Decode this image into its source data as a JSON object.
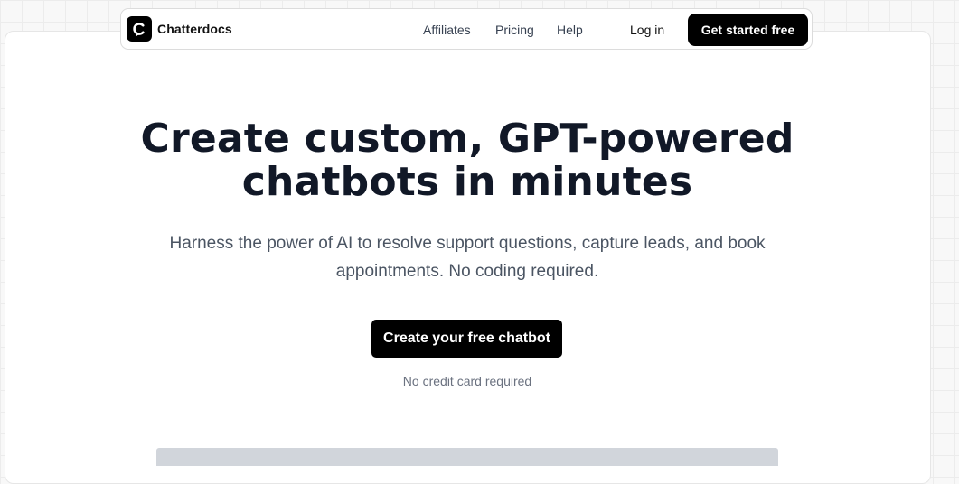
{
  "brand": {
    "name": "Chatterdocs",
    "logo_icon": "chatterdocs-logo-icon"
  },
  "nav": {
    "links": [
      "Affiliates",
      "Pricing",
      "Help"
    ],
    "login_label": "Log in",
    "cta_label": "Get started free"
  },
  "hero": {
    "title_line1": "Create custom, GPT-powered",
    "title_line2": "chatbots in minutes",
    "subtitle": "Harness the power of AI to resolve support questions, capture leads, and book appointments. No coding required.",
    "cta_label": "Create your free chatbot",
    "note": "No credit card required"
  },
  "colors": {
    "accent": "#000000",
    "heading": "#111827",
    "body_text": "#4b5563",
    "muted_text": "#6b7280",
    "preview_placeholder": "#d1d5db"
  }
}
